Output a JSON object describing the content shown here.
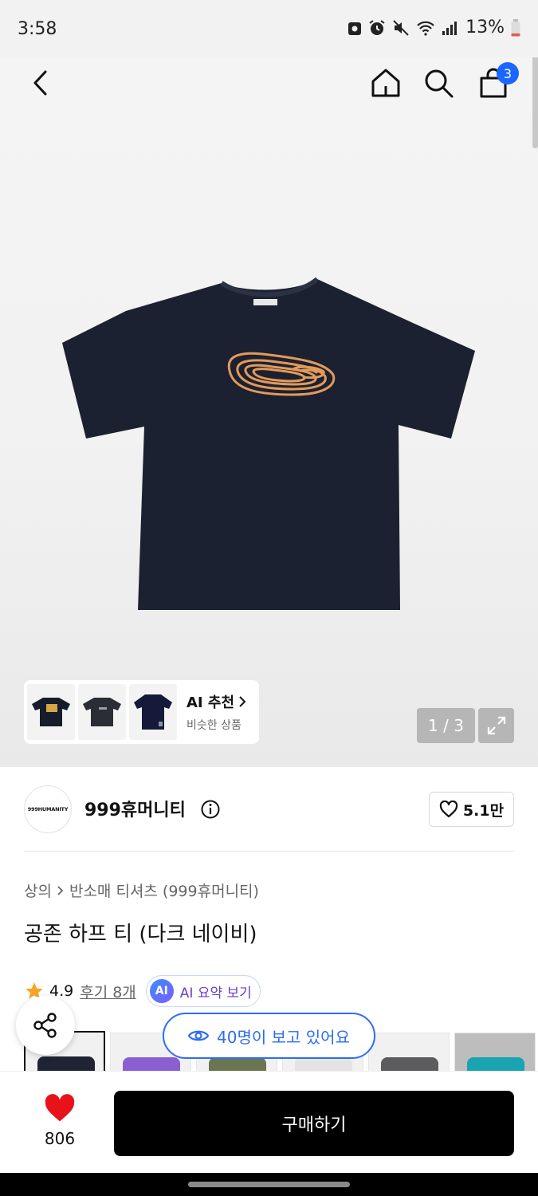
{
  "status_bar": {
    "time": "3:58",
    "battery_percent": "13%"
  },
  "nav": {
    "cart_count": "3"
  },
  "gallery": {
    "page_counter": "1 / 3",
    "ai_recommend": {
      "title": "AI 추천",
      "subtitle": "비슷한 상품"
    }
  },
  "brand": {
    "logo_text": "999HUMANITY",
    "name": "999휴머니티",
    "likes": "5.1만"
  },
  "product": {
    "breadcrumb": [
      "상의",
      "반소매 티셔츠 (999휴머니티)"
    ],
    "title": "공존 하프 티 (다크 네이비)",
    "rating": "4.9",
    "reviews": "후기 8개",
    "ai_summary_badge": "AI",
    "ai_summary_label": "AI 요약 보기",
    "viewers": "40명이 보고 있어요"
  },
  "swatch_colors": [
    "#1e2433",
    "#8a5fd1",
    "#6b7550",
    "#e4e4e4",
    "#5c5c5e",
    "#1aa3b0"
  ],
  "bottom_bar": {
    "wish_count": "806",
    "buy_label": "구매하기"
  },
  "colors": {
    "accent_blue": "#1a66ff",
    "shirt_navy": "#1b2130",
    "print_orange": "#e39a5a"
  }
}
